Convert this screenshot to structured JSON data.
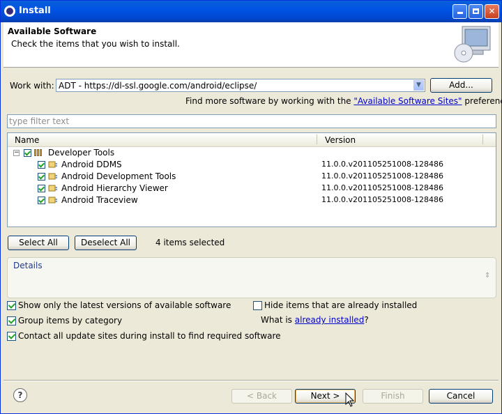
{
  "window": {
    "title": "Install"
  },
  "header": {
    "title": "Available Software",
    "description": "Check the items that you wish to install."
  },
  "work_with": {
    "label": "Work with:",
    "value": "ADT - https://dl-ssl.google.com/android/eclipse/",
    "add_button": "Add...",
    "find_more_prefix": "Find more software by working with the",
    "find_more_link": "\"Available Software Sites\"",
    "find_more_suffix": "preferences."
  },
  "filter": {
    "placeholder": "type filter text"
  },
  "tree": {
    "columns": [
      "Name",
      "Version"
    ],
    "category": {
      "name": "Developer Tools",
      "checked": true
    },
    "items": [
      {
        "name": "Android DDMS",
        "version": "11.0.0.v201105251008-128486",
        "checked": true
      },
      {
        "name": "Android Development Tools",
        "version": "11.0.0.v201105251008-128486",
        "checked": true
      },
      {
        "name": "Android Hierarchy Viewer",
        "version": "11.0.0.v201105251008-128486",
        "checked": true
      },
      {
        "name": "Android Traceview",
        "version": "11.0.0.v201105251008-128486",
        "checked": true
      }
    ]
  },
  "selection": {
    "select_all": "Select All",
    "deselect_all": "Deselect All",
    "status": "4 items selected"
  },
  "details": {
    "label": "Details"
  },
  "options": {
    "show_latest": "Show only the latest versions of available software",
    "group_by_category": "Group items by category",
    "contact_sites": "Contact all update sites during install to find required software",
    "hide_installed": "Hide items that are already installed",
    "what_is_prefix": "What is",
    "already_installed_link": "already installed",
    "what_is_suffix": "?"
  },
  "footer": {
    "back": "< Back",
    "next": "Next >",
    "finish": "Finish",
    "cancel": "Cancel"
  },
  "colors": {
    "titlebar": "#0053e4",
    "link": "#0000cc",
    "dialog_bg": "#ece9d8"
  }
}
